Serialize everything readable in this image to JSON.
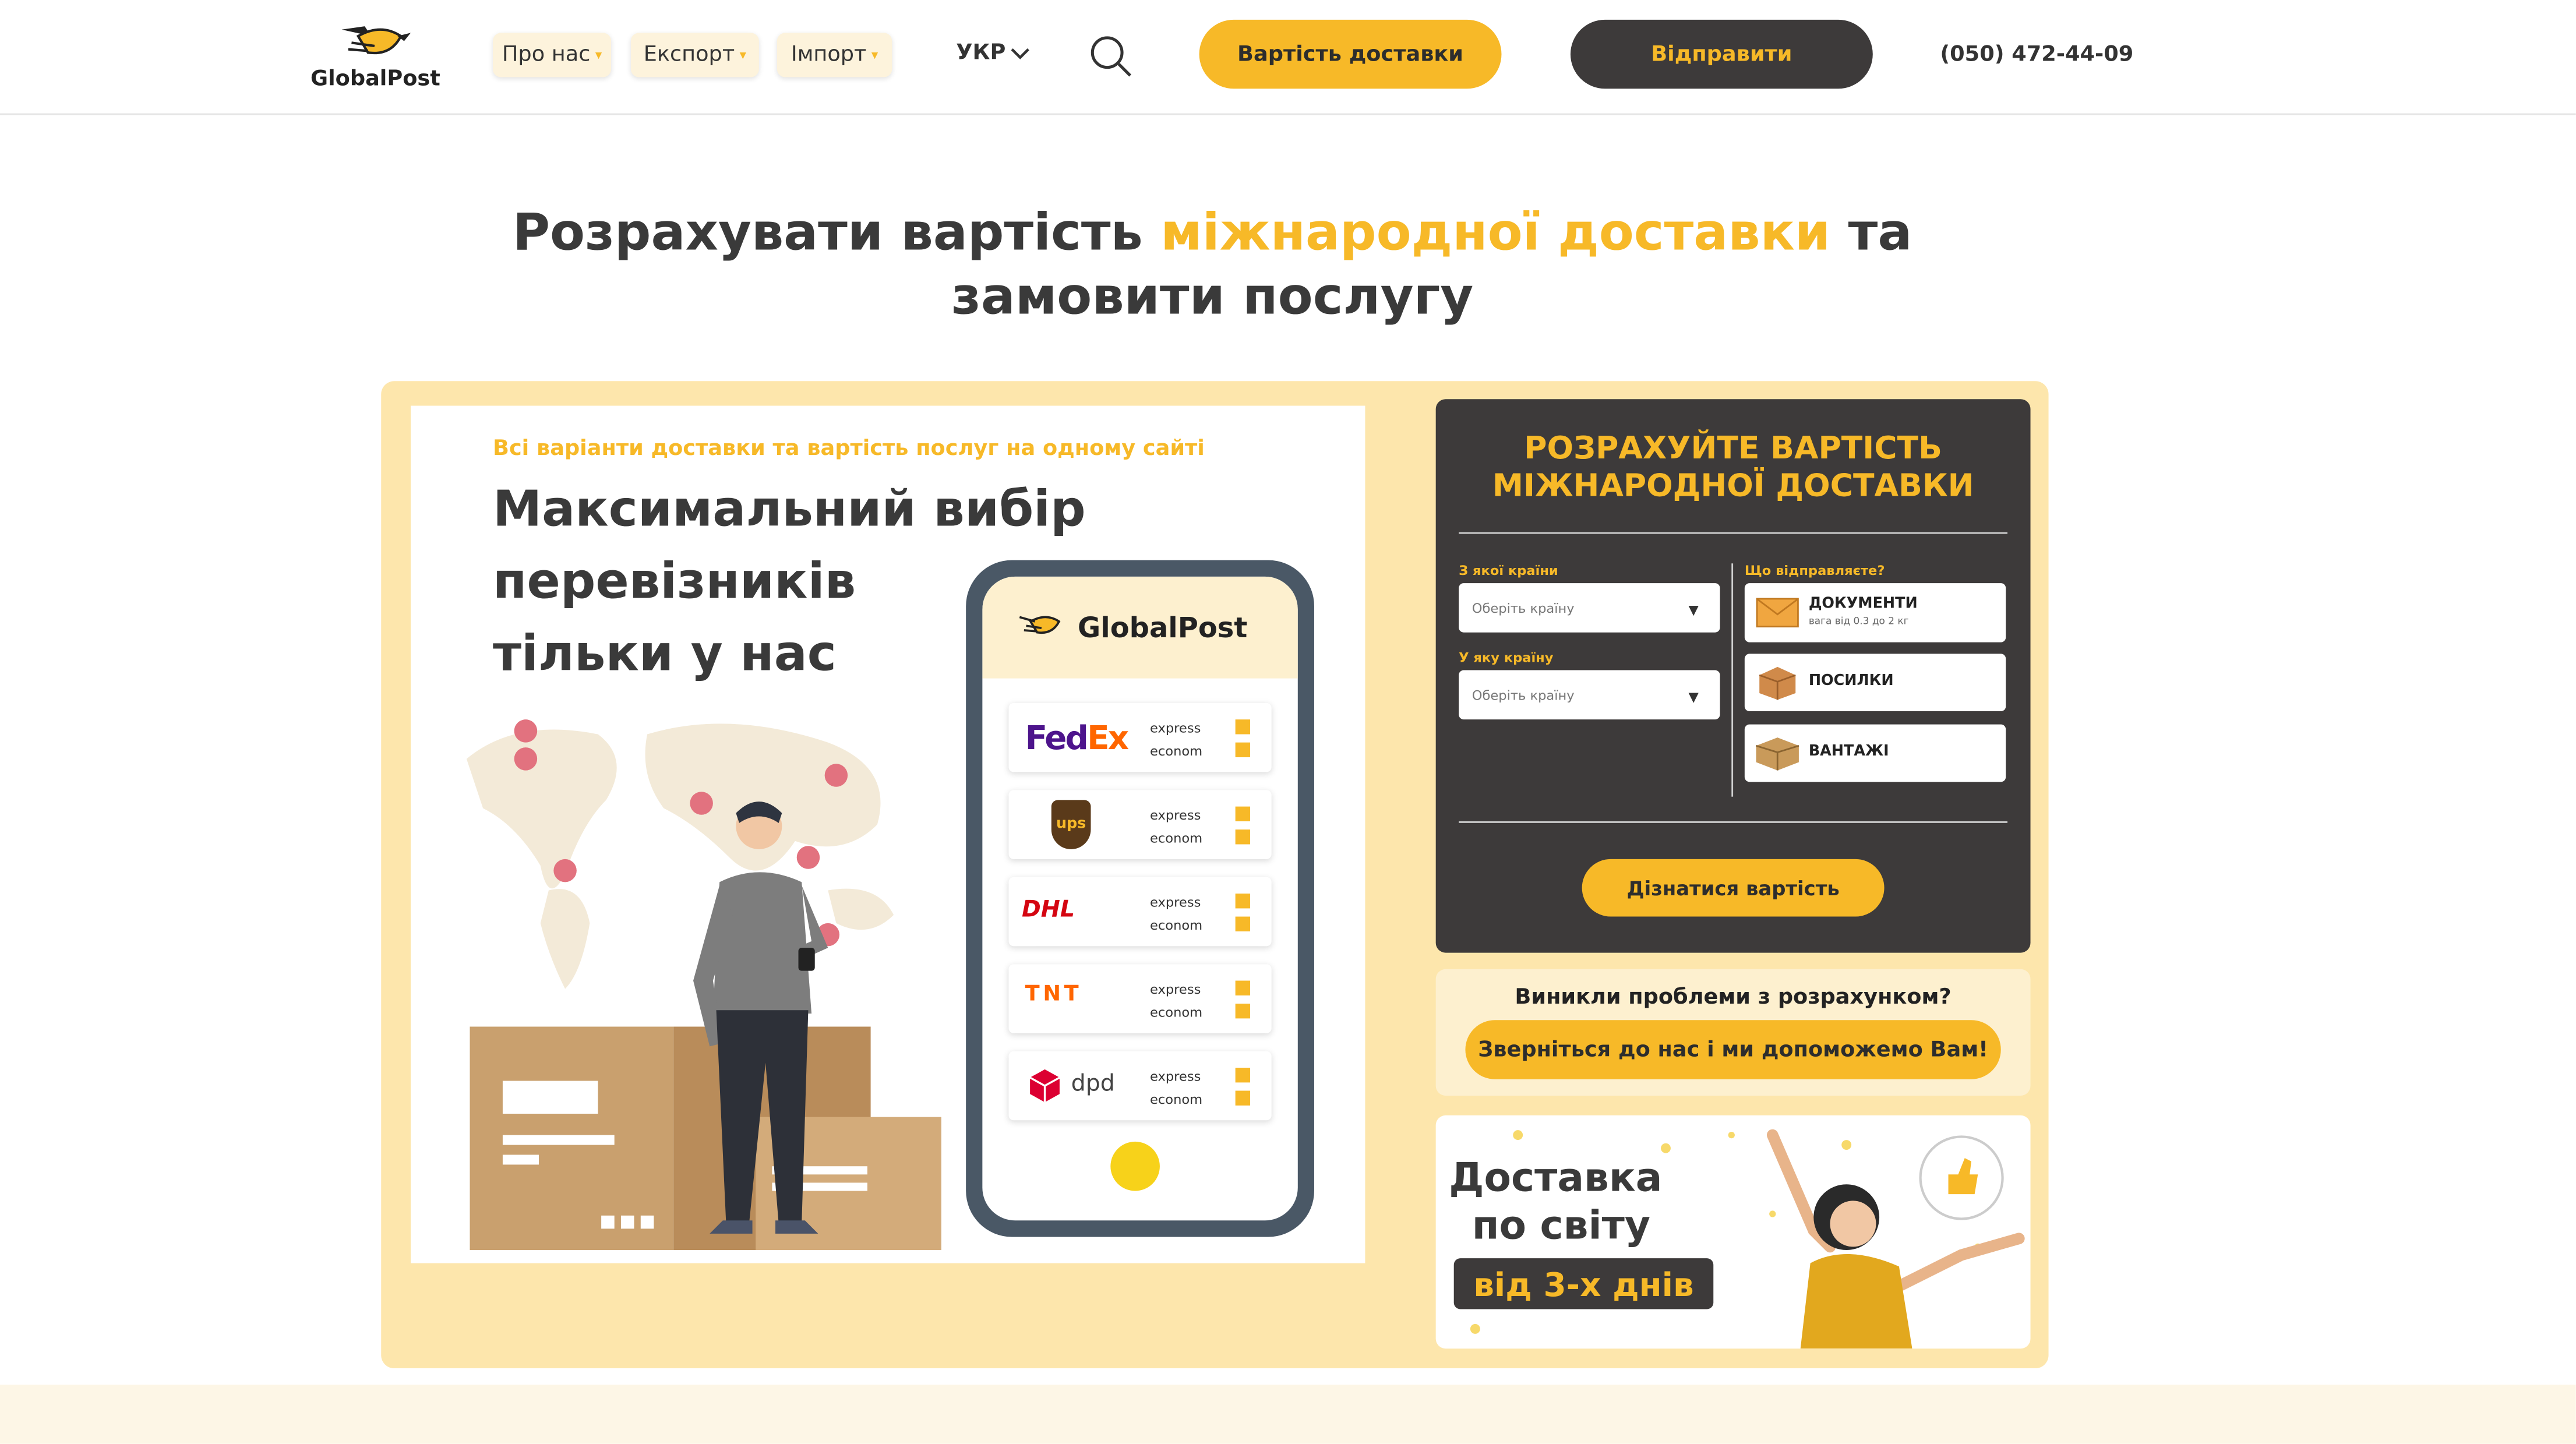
{
  "header": {
    "logo_text": "GlobalPost",
    "nav": [
      {
        "label": "Про нас"
      },
      {
        "label": "Експорт"
      },
      {
        "label": "Імпорт"
      }
    ],
    "language": "УКР",
    "cost_button": "Вартість доставки",
    "send_button": "Відправити",
    "phone": "(050) 472-44-09"
  },
  "hero": {
    "title_part1": "Розрахувати вартість",
    "title_highlight": "міжнародної доставки",
    "title_part2": "та",
    "title_line2": "замовити послугу"
  },
  "banner": {
    "tagline": "Всі варіанти доставки та вартість послуг на одному сайті",
    "headline": [
      "Максимальний вибір",
      "перевізників",
      "тільки у нас"
    ],
    "phone_brand": "GlobalPost",
    "carriers": [
      {
        "name": "FedEx",
        "options": [
          "express",
          "econom"
        ]
      },
      {
        "name": "ups",
        "options": [
          "express",
          "econom"
        ]
      },
      {
        "name": "DHL",
        "options": [
          "express",
          "econom"
        ]
      },
      {
        "name": "TNT",
        "options": [
          "express",
          "econom"
        ]
      },
      {
        "name": "dpd",
        "options": [
          "express",
          "econom"
        ]
      }
    ]
  },
  "calculator": {
    "title_line1": "РОЗРАХУЙТЕ ВАРТІСТЬ",
    "title_line2": "МІЖНАРОДНОЇ ДОСТАВКИ",
    "from_label": "З якої країни",
    "from_placeholder": "Оберіть країну",
    "to_label": "У яку країну",
    "to_placeholder": "Оберіть країну",
    "what_label": "Що відправляєте?",
    "options": [
      {
        "name": "ДОКУМЕНТИ",
        "sub": "вага від 0.3 до 2 кг",
        "icon": "envelope-icon"
      },
      {
        "name": "ПОСИЛКИ",
        "sub": "",
        "icon": "parcel-icon"
      },
      {
        "name": "ВАНТАЖІ",
        "sub": "",
        "icon": "cargo-icon"
      }
    ],
    "submit": "Дізнатися вартість"
  },
  "help": {
    "question": "Виникли проблеми з розрахунком?",
    "button": "Зверніться до нас і ми допоможемо Вам!"
  },
  "promo": {
    "line1": "Доставка",
    "line2": "по світу",
    "badge": "від 3-х днів"
  },
  "colors": {
    "accent": "#f7b928",
    "dark": "#3d3a3a",
    "panel": "#fde6ac"
  }
}
